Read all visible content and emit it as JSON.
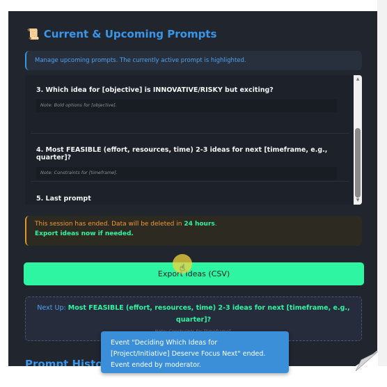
{
  "section": {
    "icon": "scroll-icon",
    "title": "Current & Upcoming Prompts"
  },
  "info_banner": "Manage upcoming prompts. The currently active prompt is highlighted.",
  "prompts": [
    {
      "title": "3. Which idea for [objective] is INNOVATIVE/RISKY but exciting?",
      "note": "Note: Bold options for [objective]."
    },
    {
      "title": "4. Most FEASIBLE (effort, resources, time) 2-3 ideas for next [timeframe, e.g., quarter]?",
      "note": "Note: Constraints for [timeframe]."
    },
    {
      "title": "5. Last prompt",
      "note": ""
    }
  ],
  "warning": {
    "text_before": "This session has ended. Data will be deleted in ",
    "highlight": "24 hours",
    "text_after": ".",
    "line2": "Export ideas now if needed."
  },
  "export_button": "Export Ideas (CSV)",
  "next_up": {
    "label": "Next Up:",
    "prompt": "Most FEASIBLE (effort, resources, time) 2-3 ideas for next [timeframe, e.g., quarter]?",
    "note": "Note: Constraints for [timeframe]."
  },
  "history_heading": "Prompt History",
  "toast": {
    "line1": "Event \"Deciding Which Ideas for",
    "line2": "[Project/Initiative] Deserve Focus Next\" ended.",
    "line3": "Event ended by moderator."
  },
  "colors": {
    "accent_blue": "#3a96e8",
    "accent_green": "#2ef5a1",
    "warning_orange": "#f29a33",
    "panel_bg": "#20252e"
  }
}
